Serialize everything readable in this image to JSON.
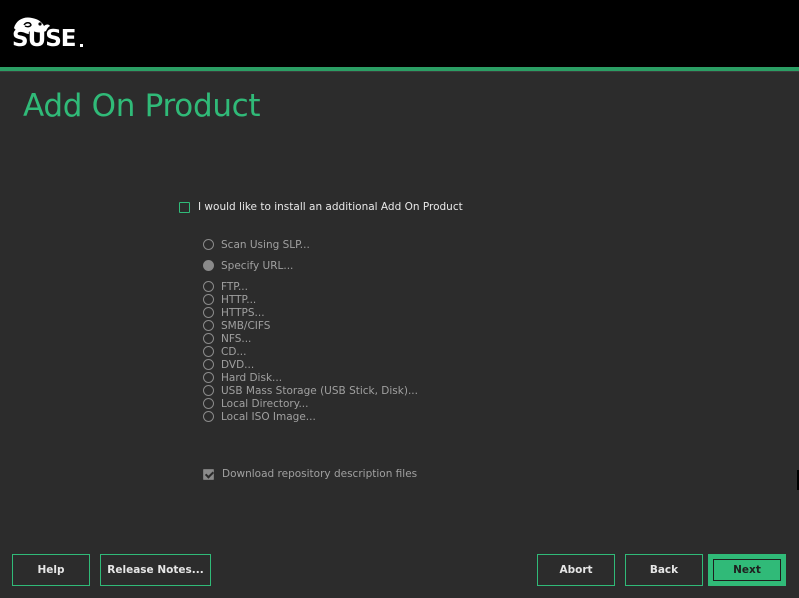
{
  "header": {
    "logo_text": "SUSE",
    "brand_color": "#30ba78",
    "accent_line_color": "#2b9e64"
  },
  "page": {
    "title": "Add On Product"
  },
  "addon_checkbox": {
    "label": "I would like to install an additional Add On Product",
    "checked": false
  },
  "options": [
    {
      "label": "Scan Using SLP...",
      "selected": false
    },
    {
      "label": "Specify URL...",
      "selected": true
    },
    {
      "label": "FTP...",
      "selected": false
    },
    {
      "label": "HTTP...",
      "selected": false
    },
    {
      "label": "HTTPS...",
      "selected": false
    },
    {
      "label": "SMB/CIFS",
      "selected": false
    },
    {
      "label": "NFS...",
      "selected": false
    },
    {
      "label": "CD...",
      "selected": false
    },
    {
      "label": "DVD...",
      "selected": false
    },
    {
      "label": "Hard Disk...",
      "selected": false
    },
    {
      "label": "USB Mass Storage (USB Stick, Disk)...",
      "selected": false
    },
    {
      "label": "Local Directory...",
      "selected": false
    },
    {
      "label": "Local ISO Image...",
      "selected": false
    }
  ],
  "download_checkbox": {
    "label": "Download repository description files",
    "checked": true
  },
  "buttons": {
    "help": "Help",
    "release_notes": "Release Notes...",
    "abort": "Abort",
    "back": "Back",
    "next": "Next"
  }
}
